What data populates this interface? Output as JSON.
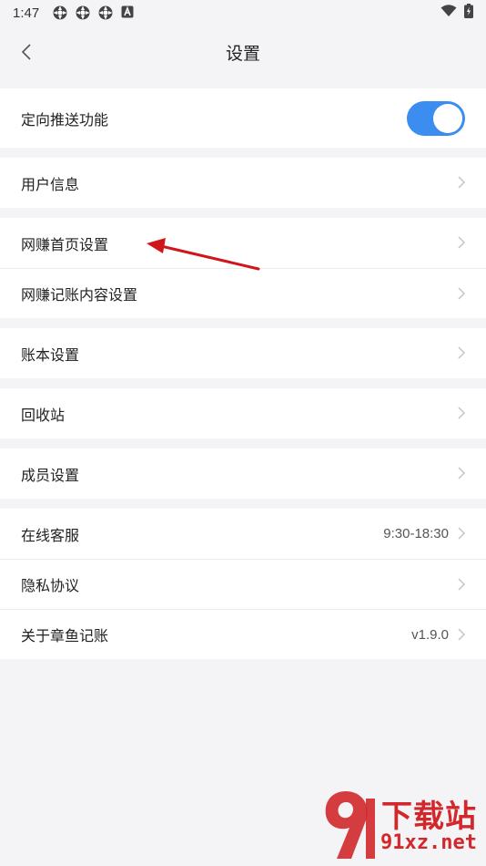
{
  "status_bar": {
    "time": "1:47"
  },
  "nav": {
    "title": "设置"
  },
  "push": {
    "label": "定向推送功能",
    "enabled": true
  },
  "groups": {
    "user": {
      "label": "用户信息"
    },
    "wangzhuan": {
      "home": "网赚首页设置",
      "content": "网赚记账内容设置"
    },
    "ledger": {
      "label": "账本设置"
    },
    "recycle": {
      "label": "回收站"
    },
    "members": {
      "label": "成员设置"
    },
    "about": {
      "service_label": "在线客服",
      "service_value": "9:30-18:30",
      "privacy_label": "隐私协议",
      "about_label": "关于章鱼记账",
      "version": "v1.9.0"
    }
  },
  "watermark": {
    "title": "下载站",
    "url": "91xz.net",
    "logo_text": "91"
  },
  "colors": {
    "accent": "#3b8ef0",
    "annotation": "#d0161b"
  }
}
